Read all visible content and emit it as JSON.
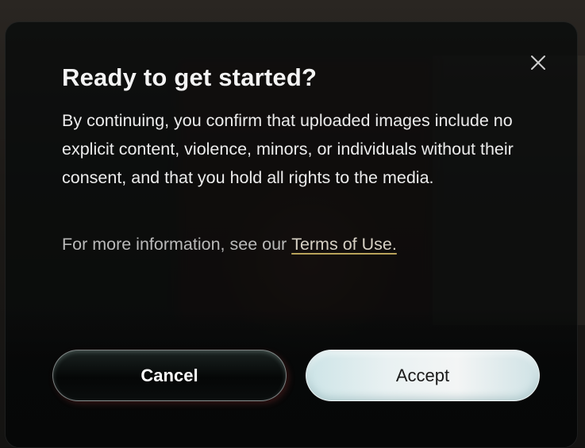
{
  "dialog": {
    "title": "Ready to get started?",
    "body": "By continuing, you confirm that uploaded images include no explicit content, violence, minors, or individuals without their consent, and that you hold all rights to the media.",
    "info_prefix": "For more information, see our",
    "terms_link": "Terms of Use.",
    "close_icon": "close-icon",
    "buttons": {
      "cancel": "Cancel",
      "accept": "Accept"
    }
  },
  "colors": {
    "dialog_background": "#080a0a",
    "title": "#f4f4f4",
    "link_underline": "#b8a25a",
    "accept_button": "#e9f1f2",
    "cancel_button": "#050707"
  }
}
